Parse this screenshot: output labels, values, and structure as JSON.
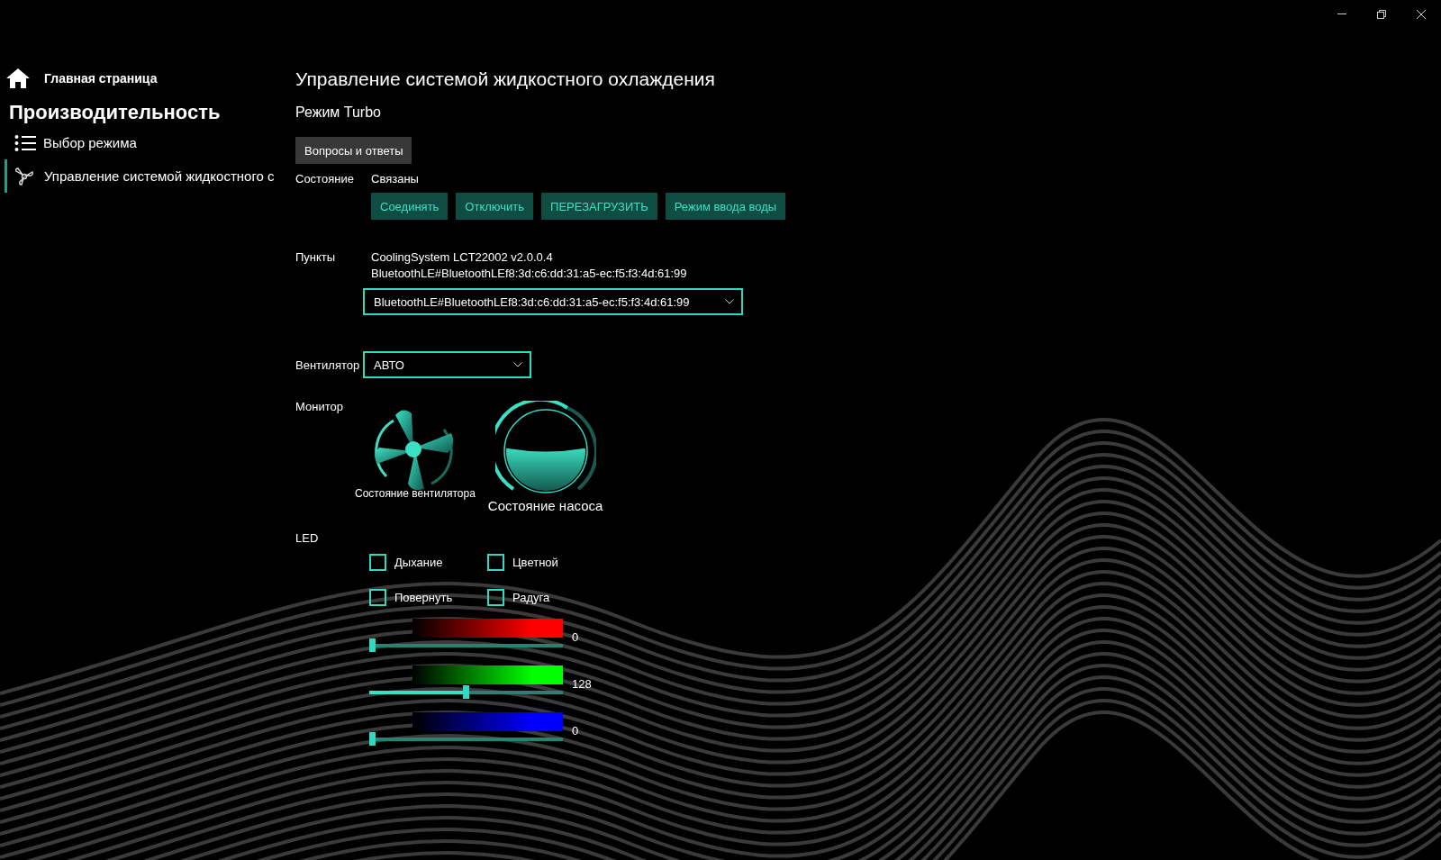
{
  "sidebar": {
    "home": "Главная страница",
    "section_title": "Производительность",
    "items": [
      {
        "label": "Выбор режима",
        "selected": false
      },
      {
        "label": "Управление системой жидкостного с",
        "selected": true
      }
    ]
  },
  "main": {
    "title": "Управление системой жидкостного охлаждения",
    "subtitle": "Режим Turbo",
    "faq_button": "Вопросы и ответы",
    "status": {
      "label": "Состояние",
      "value": "Связаны"
    },
    "actions": [
      "Соединять",
      "Отключить",
      "ПЕРЕЗАГРУЗИТЬ",
      "Режим ввода воды"
    ],
    "devices": {
      "label": "Пункты",
      "lines": [
        "CoolingSystem LCT22002 v2.0.0.4",
        "BluetoothLE#BluetoothLEf8:3d:c6:dd:31:a5-ec:f5:f3:4d:61:99"
      ],
      "dropdown": "BluetoothLE#BluetoothLEf8:3d:c6:dd:31:a5-ec:f5:f3:4d:61:99"
    },
    "fan": {
      "label": "Вентилятор",
      "dropdown": "АВТО"
    },
    "monitor": {
      "label": "Монитор",
      "fan_status": "Состояние вентилятора",
      "pump_status": "Состояние насоса"
    },
    "led": {
      "label": "LED",
      "options": [
        {
          "label": "Дыхание",
          "checked": false
        },
        {
          "label": "Цветной",
          "checked": false
        },
        {
          "label": "Повернуть",
          "checked": false
        },
        {
          "label": "Радуга",
          "checked": false
        }
      ],
      "sliders": [
        {
          "color": "#ff0000",
          "level": 0,
          "reading": "0"
        },
        {
          "color": "#00ff00",
          "level": 0.502,
          "reading": "128"
        },
        {
          "color": "#0000ff",
          "level": 0,
          "reading": "0"
        }
      ]
    }
  }
}
